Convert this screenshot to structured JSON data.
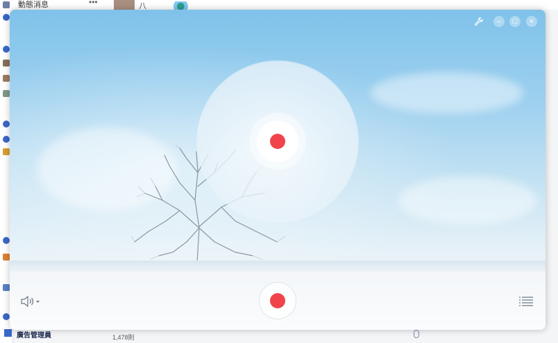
{
  "background_window": {
    "top_label": "動態消息",
    "more_label": "•••",
    "separator_text": "八",
    "bottom_label": "廣告管理員",
    "bottom_count": "1,478則"
  },
  "recorder": {
    "controls": {
      "settings_icon": "wrench-icon",
      "minimize_icon": "minimize-icon",
      "maximize_icon": "maximize-icon",
      "close_icon": "close-icon",
      "minimize_glyph": "–",
      "maximize_glyph": "□",
      "close_glyph": "×"
    },
    "record_color": "#f0444a",
    "speaker_icon": "speaker-icon",
    "menu_icon": "list-menu-icon"
  }
}
